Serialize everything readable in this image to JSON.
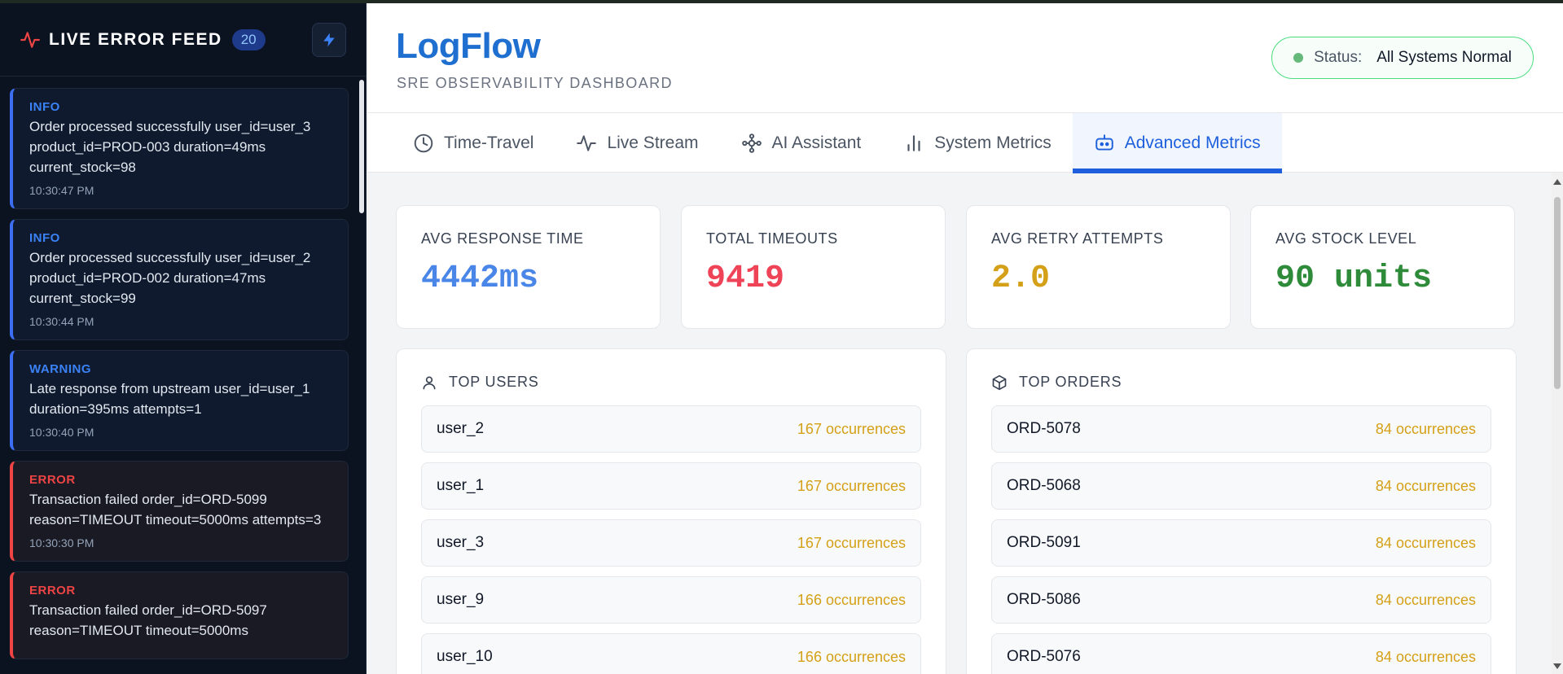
{
  "sidebar": {
    "title": "LIVE ERROR FEED",
    "count": "20",
    "feed": [
      {
        "level": "INFO",
        "message": "Order processed successfully user_id=user_3 product_id=PROD-003 duration=49ms current_stock=98",
        "time": "10:30:47 PM"
      },
      {
        "level": "INFO",
        "message": "Order processed successfully user_id=user_2 product_id=PROD-002 duration=47ms current_stock=99",
        "time": "10:30:44 PM"
      },
      {
        "level": "WARNING",
        "message": "Late response from upstream user_id=user_1 duration=395ms attempts=1",
        "time": "10:30:40 PM"
      },
      {
        "level": "ERROR",
        "message": "Transaction failed order_id=ORD-5099 reason=TIMEOUT timeout=5000ms attempts=3",
        "time": "10:30:30 PM"
      },
      {
        "level": "ERROR",
        "message": "Transaction failed order_id=ORD-5097 reason=TIMEOUT timeout=5000ms",
        "time": ""
      }
    ]
  },
  "header": {
    "brand": "LogFlow",
    "subtitle": "SRE OBSERVABILITY DASHBOARD",
    "status_label": "Status:",
    "status_value": "All Systems Normal"
  },
  "tabs": [
    {
      "label": "Time-Travel",
      "icon": "clock-icon"
    },
    {
      "label": "Live Stream",
      "icon": "activity-icon"
    },
    {
      "label": "AI Assistant",
      "icon": "network-icon"
    },
    {
      "label": "System Metrics",
      "icon": "bar-chart-icon"
    },
    {
      "label": "Advanced Metrics",
      "icon": "bot-icon",
      "active": true
    }
  ],
  "metrics": [
    {
      "label": "AVG RESPONSE TIME",
      "value": "4442ms",
      "color": "#4a86e8"
    },
    {
      "label": "TOTAL TIMEOUTS",
      "value": "9419",
      "color": "#ef4458"
    },
    {
      "label": "AVG RETRY ATTEMPTS",
      "value": "2.0",
      "color": "#d4a017"
    },
    {
      "label": "AVG STOCK LEVEL",
      "value": "90 units",
      "color": "#2e8b3a"
    }
  ],
  "top_users": {
    "title": "TOP USERS",
    "rows": [
      {
        "name": "user_2",
        "count": "167 occurrences"
      },
      {
        "name": "user_1",
        "count": "167 occurrences"
      },
      {
        "name": "user_3",
        "count": "167 occurrences"
      },
      {
        "name": "user_9",
        "count": "166 occurrences"
      },
      {
        "name": "user_10",
        "count": "166 occurrences"
      }
    ]
  },
  "top_orders": {
    "title": "TOP ORDERS",
    "rows": [
      {
        "name": "ORD-5078",
        "count": "84 occurrences"
      },
      {
        "name": "ORD-5068",
        "count": "84 occurrences"
      },
      {
        "name": "ORD-5091",
        "count": "84 occurrences"
      },
      {
        "name": "ORD-5086",
        "count": "84 occurrences"
      },
      {
        "name": "ORD-5076",
        "count": "84 occurrences"
      }
    ]
  }
}
